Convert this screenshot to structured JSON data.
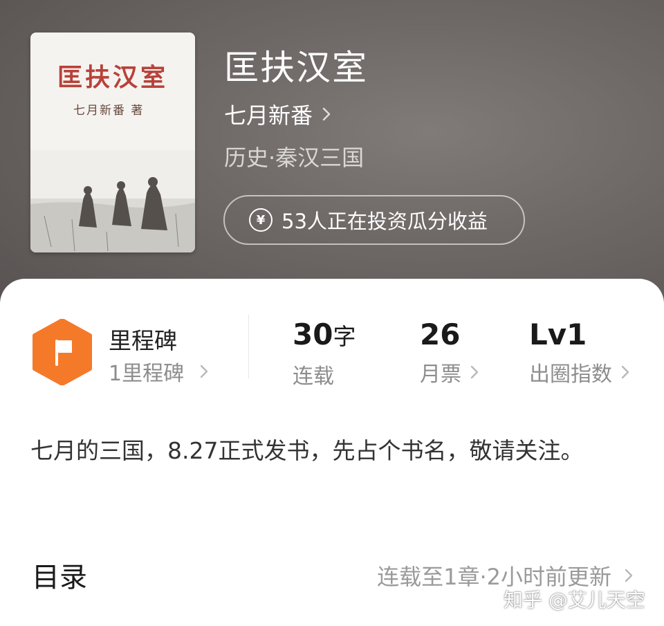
{
  "book": {
    "cover": {
      "title": "匡扶汉室",
      "author": "七月新番 著"
    },
    "title": "匡扶汉室",
    "author": "七月新番",
    "genre": "历史·秦汉三国",
    "invest_text": "53人正在投资瓜分收益"
  },
  "stats": {
    "milestone_title": "里程碑",
    "milestone_sub": "1里程碑",
    "words_value": "30",
    "words_unit": "字",
    "words_label": "连载",
    "tickets_value": "26",
    "tickets_label": "月票",
    "level_value": "Lv1",
    "level_label": "出圈指数"
  },
  "description": "七月的三国，8.27正式发书，先占个书名，敬请关注。",
  "toc": {
    "title": "目录",
    "status": "连载至1章·2小时前更新"
  },
  "watermark": "知乎 @艾儿天空",
  "colors": {
    "header_bg": "#6e6866",
    "milestone_orange": "#f47a2a",
    "cover_title_red": "#b8413a"
  },
  "icons": {
    "milestone": "flag-icon",
    "invest": "yen-coin-icon",
    "chevron": "chevron-right-icon"
  }
}
